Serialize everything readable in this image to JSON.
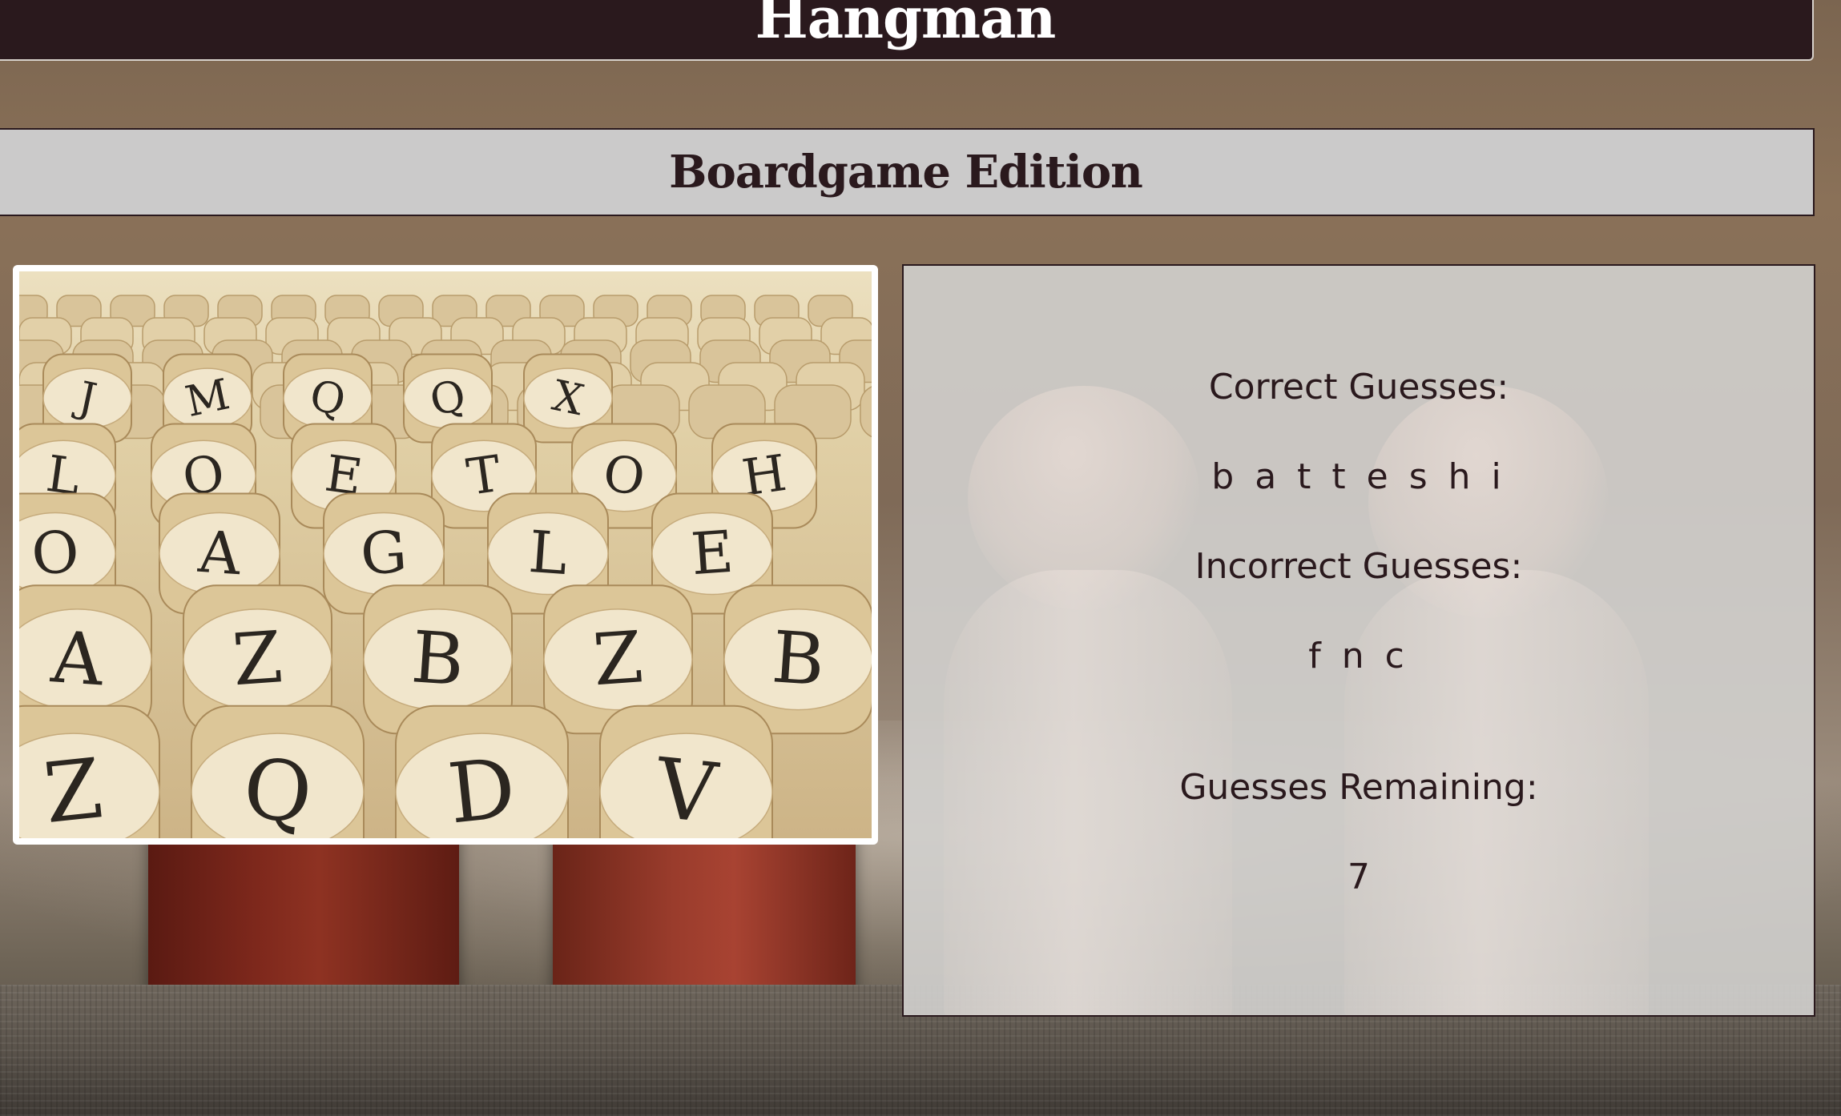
{
  "header": {
    "title": "Hangman"
  },
  "subheader": {
    "title": "Boardgame Edition"
  },
  "stats": {
    "correct_label": "Correct Guesses:",
    "correct_value": "b a t t e s h i",
    "incorrect_label": "Incorrect Guesses:",
    "incorrect_value": "f n c",
    "remaining_label": "Guesses Remaining:",
    "remaining_value": "7"
  },
  "dice": {
    "letters_row1": [
      "Z",
      "Q",
      "D",
      "V"
    ],
    "letters_row2": [
      "A",
      "Z",
      "B",
      "Z",
      "B"
    ],
    "letters_row3": [
      "O",
      "A",
      "G",
      "L",
      "E"
    ],
    "letters_row4": [
      "L",
      "O",
      "E",
      "T",
      "O",
      "H"
    ],
    "letters_row5": [
      "J",
      "M",
      "Q",
      "Q",
      "X"
    ]
  },
  "colors": {
    "header_bg": "#2a191d",
    "header_text": "#ffffff",
    "subheader_bg": "#cbcaca",
    "panel_text": "#2a191d"
  }
}
